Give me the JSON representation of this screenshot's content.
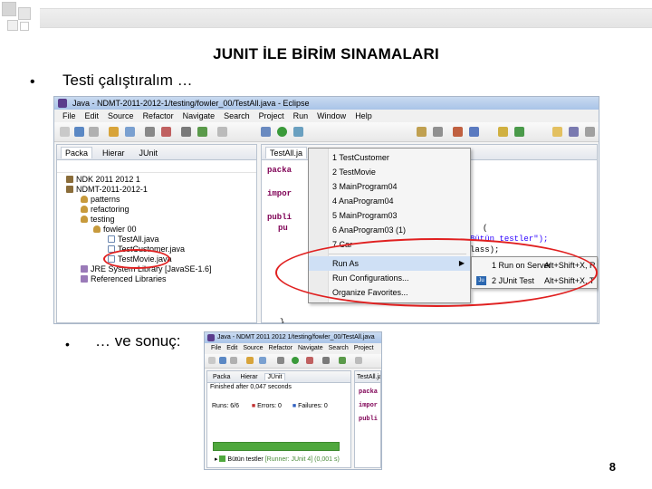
{
  "slide": {
    "title": "JUNIT İLE BİRİM SINAMALARI",
    "bullet_char": "•",
    "bullet1": "Testi çalıştıralım …",
    "bullet2": "… ve sonuç:",
    "page_number": "8"
  },
  "eclipse": {
    "window_title": "Java - NDMT-2011-2012-1/testing/fowler_00/TestAll.java - Eclipse",
    "menu": [
      "File",
      "Edit",
      "Source",
      "Refactor",
      "Navigate",
      "Search",
      "Project",
      "Run",
      "Window",
      "Help"
    ],
    "left_tabs": [
      "Packa",
      "Hierar",
      "JUnit"
    ],
    "tree": [
      {
        "label": "NDK 2011 2012 1",
        "level": 0,
        "icon": "project-icon"
      },
      {
        "label": "NDMT-2011-2012-1",
        "level": 0,
        "icon": "project-icon"
      },
      {
        "label": "patterns",
        "level": 1,
        "icon": "package-icon"
      },
      {
        "label": "refactoring",
        "level": 1,
        "icon": "package-icon"
      },
      {
        "label": "testing",
        "level": 1,
        "icon": "package-icon"
      },
      {
        "label": "fowler 00",
        "level": 2,
        "icon": "package-icon"
      },
      {
        "label": "TestAll.java",
        "level": 3,
        "icon": "java-file-icon"
      },
      {
        "label": "TestCustomer.java",
        "level": 3,
        "icon": "java-file-icon"
      },
      {
        "label": "TestMovie.java",
        "level": 3,
        "icon": "java-file-icon"
      },
      {
        "label": "JRE System Library [JavaSE-1.6]",
        "level": 1,
        "icon": "library-icon"
      },
      {
        "label": "Referenced Libraries",
        "level": 1,
        "icon": "library-icon"
      }
    ],
    "editor_tab": "TestAll.ja",
    "code": {
      "line1": "packa",
      "line2": "impor",
      "line3": "publi",
      "line4": "pu",
      "line5": "(",
      "line6": "estSuite(\"Bütün testler\");",
      "line7": "Customer.class);",
      "line8": "}"
    },
    "run_menu": {
      "items": [
        "1 TestCustomer",
        "2 TestMovie",
        "3 MainProgram04",
        "4 AnaProgram04",
        "5 MainProgram03",
        "6 AnaProgram03 (1)",
        "7 Car"
      ],
      "run_as": "Run As",
      "run_configurations": "Run Configurations...",
      "organize_favorites": "Organize Favorites..."
    },
    "run_as_submenu": [
      {
        "label": "1 Run on Server",
        "shortcut": "Alt+Shift+X, R"
      },
      {
        "label": "2 JUnit Test",
        "shortcut": "Alt+Shift+X, T"
      }
    ]
  },
  "eclipse2": {
    "window_title": "Java - NDMT 2011 2012 1/testing/fowler_00/TestAll.java",
    "menu": [
      "File",
      "Edit",
      "Source",
      "Refactor",
      "Navigate",
      "Search",
      "Project"
    ],
    "tabs": [
      "Packa",
      "Hierar",
      "JUnit"
    ],
    "editor_tab": "TestAll.ja",
    "finished": "Finished after 0,047 seconds",
    "runs": "Runs: 6/6",
    "errors": "Errors: 0",
    "failures": "Failures: 0",
    "suite": "Bütün testler",
    "suite_runner": "[Runner: JUnit 4] (0,001 s)",
    "code": [
      "packa",
      "impor",
      "publi"
    ]
  },
  "colors": {
    "annotation_ring": "#e02020",
    "junit_success": "#4fa83d"
  }
}
